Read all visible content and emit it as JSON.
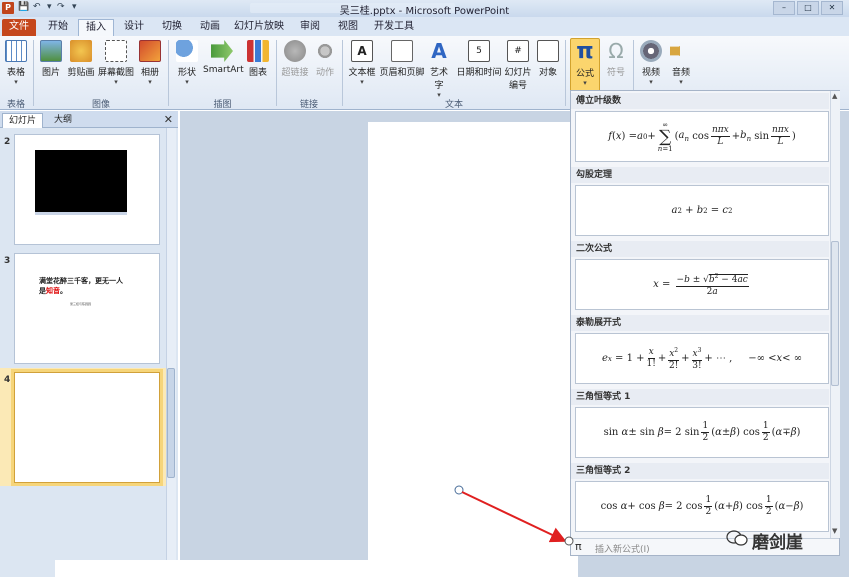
{
  "window": {
    "title": "吴三桂.pptx - Microsoft PowerPoint"
  },
  "tabs": [
    "文件",
    "开始",
    "插入",
    "设计",
    "切换",
    "动画",
    "幻灯片放映",
    "审阅",
    "视图",
    "开发工具"
  ],
  "ribbon": {
    "buttons": {
      "table": "表格",
      "picture": "图片",
      "clipart": "剪贴画",
      "screenshot": "屏幕截图",
      "album": "相册",
      "shapes": "形状",
      "smartart": "SmartArt",
      "chart": "图表",
      "hyperlink": "超链接",
      "action": "动作",
      "textbox": "文本框",
      "headerfooter": "页眉和页脚",
      "wordart": "艺术字",
      "datetime": "日期和时间",
      "slidenum1": "幻灯片",
      "slidenum2": "编号",
      "object": "对象",
      "equation": "公式",
      "symbol": "符号",
      "video": "视频",
      "audio": "音频"
    },
    "groups": {
      "tables": "表格",
      "images": "图像",
      "illustrations": "插图",
      "links": "链接",
      "text": "文本"
    }
  },
  "left_pane": {
    "tabs": {
      "slides": "幻灯片",
      "outline": "大纲"
    },
    "slides": [
      {
        "number": "2"
      },
      {
        "number": "3",
        "text_black": "满堂花醉三千客，更无一人",
        "text_black2": "是",
        "text_red": "知音",
        "text_end": "。",
        "subtitle": "吴三桂与陈圆圆"
      },
      {
        "number": "4"
      }
    ]
  },
  "equation_gallery": {
    "sections": [
      {
        "title": "傅立叶级数"
      },
      {
        "title": "勾股定理"
      },
      {
        "title": "二次公式"
      },
      {
        "title": "泰勒展开式"
      },
      {
        "title": "三角恒等式 1"
      },
      {
        "title": "三角恒等式 2"
      }
    ],
    "insert_new": "插入新公式(I)",
    "pi_symbol": "π"
  },
  "watermark": "磨剑崖"
}
